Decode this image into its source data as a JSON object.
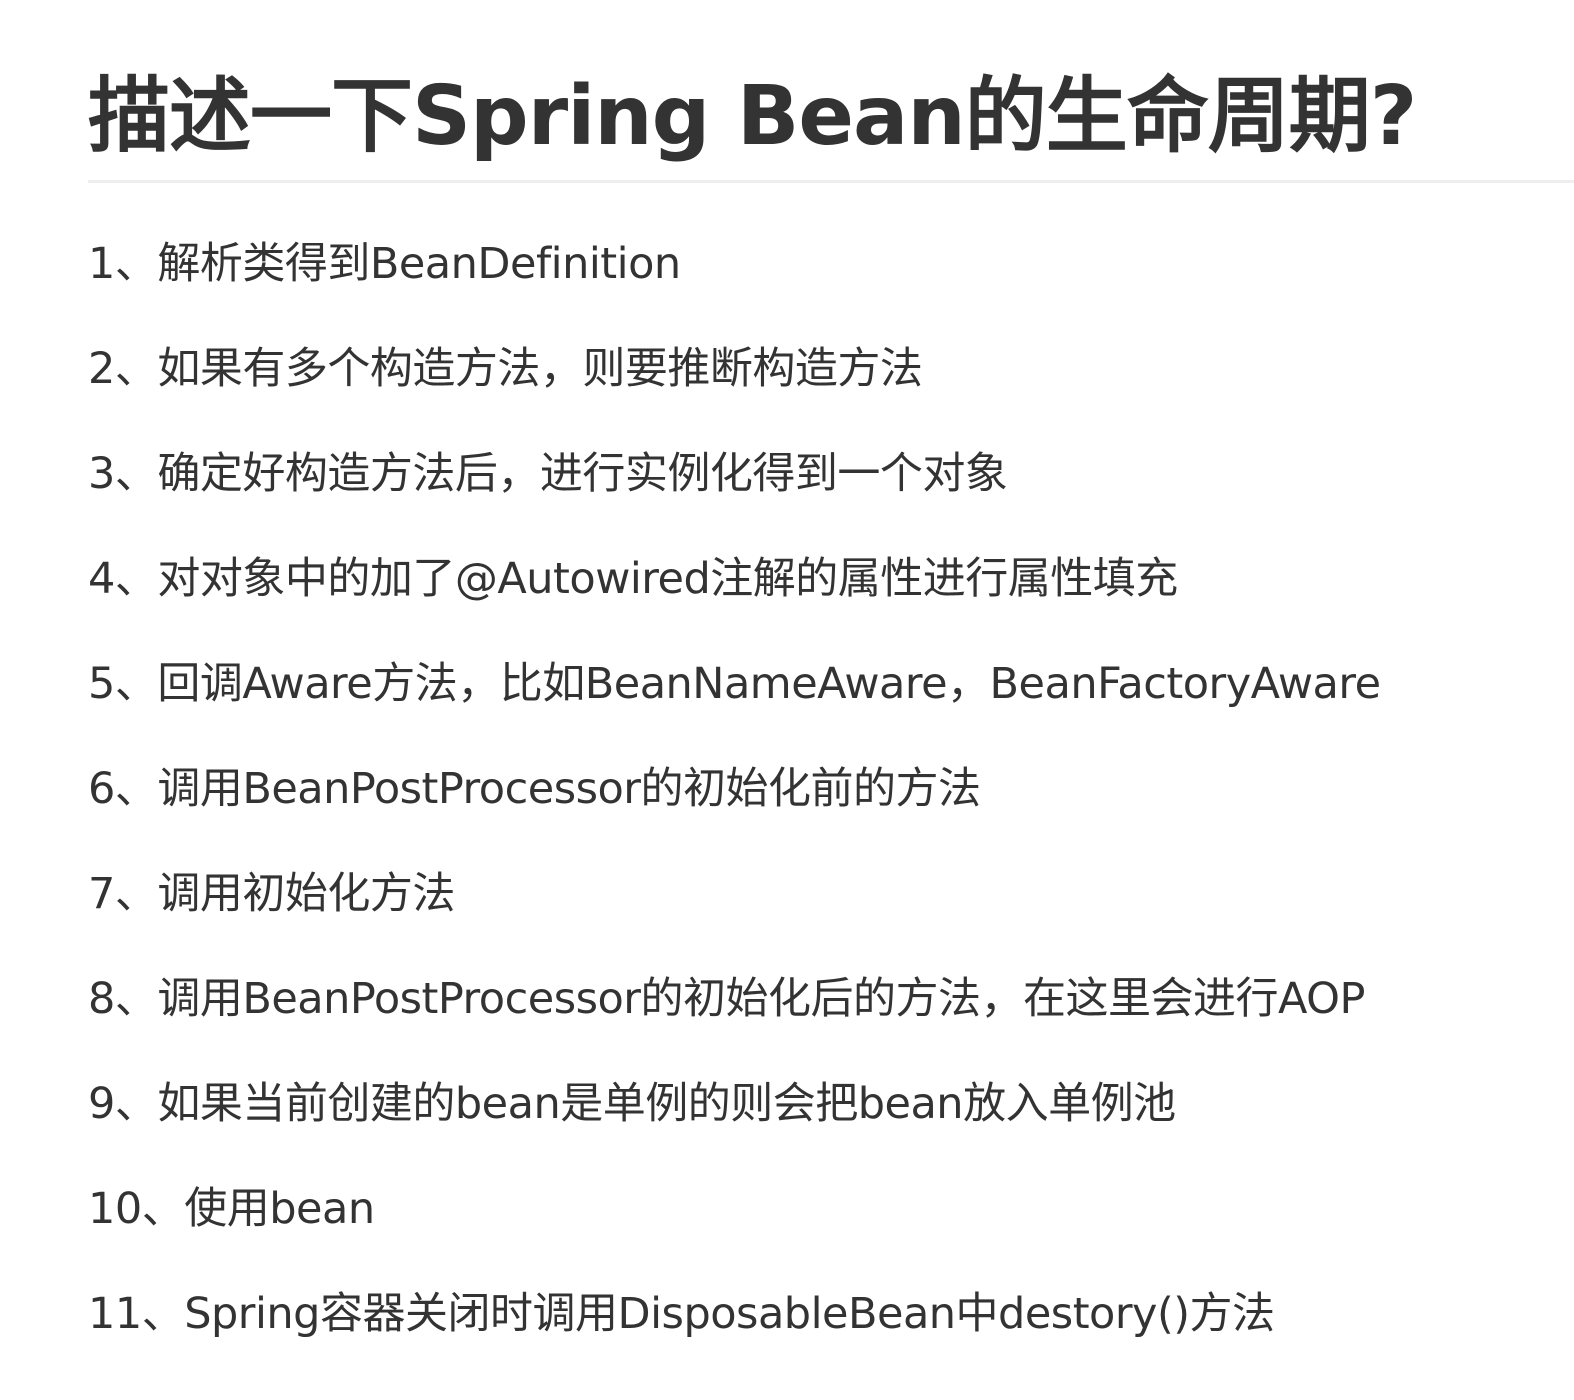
{
  "title": "描述一下Spring Bean的生命周期?",
  "steps": [
    "1、解析类得到BeanDefinition",
    "2、如果有多个构造方法，则要推断构造方法",
    "3、确定好构造方法后，进行实例化得到一个对象",
    "4、对对象中的加了@Autowired注解的属性进行属性填充",
    "5、回调Aware方法，比如BeanNameAware，BeanFactoryAware",
    "6、调用BeanPostProcessor的初始化前的方法",
    "7、调用初始化方法",
    "8、调用BeanPostProcessor的初始化后的方法，在这里会进行AOP",
    "9、如果当前创建的bean是单例的则会把bean放入单例池",
    "10、使用bean",
    "11、Spring容器关闭时调用DisposableBean中destory()方法"
  ]
}
